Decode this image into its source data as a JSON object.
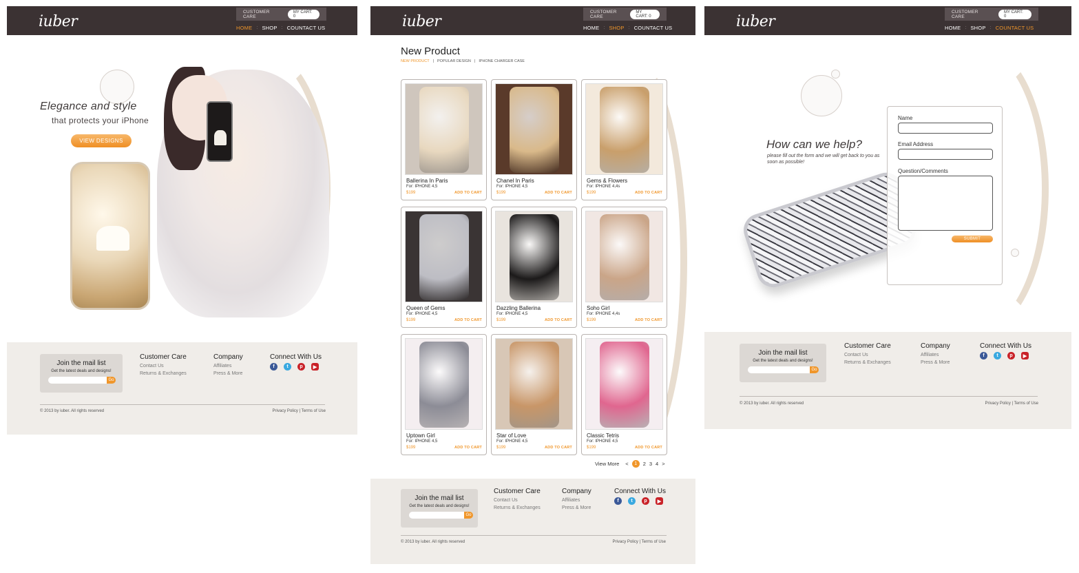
{
  "brand": {
    "logo": "iuber",
    "accent": "#f0962a",
    "header_bg": "#3b3233",
    "footer_bg": "#f0ede9"
  },
  "header": {
    "customer_care": "CUSTOMER CARE",
    "cart": "MY CART: 0",
    "nav": [
      "HOME",
      "SHOP",
      "COUNTACT US"
    ]
  },
  "home": {
    "title": "Elegance and style",
    "subtitle": "that protects your iPhone",
    "cta": "VIEW DESIGNS"
  },
  "shop": {
    "title": "New Product",
    "tabs": [
      "NEW PRODUCT",
      "POPULAR DESIGN",
      "IPHONE CHARGER CASE"
    ],
    "add_label": "ADD TO CART",
    "products": [
      {
        "name": "Ballerina In Paris",
        "for": "For: IPHONE 4,5",
        "price": "$199",
        "bg": "#cfc6bd",
        "case": "#e8d8bf"
      },
      {
        "name": "Chanel In Paris",
        "for": "For: IPHONE 4,5",
        "price": "$199",
        "bg": "#5a3a2a",
        "case": "#d9b98a"
      },
      {
        "name": "Gems & Flowers",
        "for": "For: IPHONE 4,4s",
        "price": "$199",
        "bg": "#f3e9dc",
        "case": "#c99f6b"
      },
      {
        "name": "Queen of Gems",
        "for": "For: IPHONE 4,5",
        "price": "$199",
        "bg": "#3a3434",
        "case": "#bdbdc4"
      },
      {
        "name": "Dazzling Ballerina",
        "for": "For: IPHONE 4,5",
        "price": "$199",
        "bg": "#e9e4de",
        "case": "#1c1a1a"
      },
      {
        "name": "Soho Girl",
        "for": "For: IPHONE 4,4s",
        "price": "$199",
        "bg": "#f1e7e3",
        "case": "#caa588"
      },
      {
        "name": "Uptown Girl",
        "for": "For: IPHONE 4,5",
        "price": "$199",
        "bg": "#f4eef0",
        "case": "#8c8c96"
      },
      {
        "name": "Star of Love",
        "for": "For: IPHONE 4,5",
        "price": "$199",
        "bg": "#d8c7b6",
        "case": "#c89668"
      },
      {
        "name": "Classic Tetris",
        "for": "For: IPHONE 4,5",
        "price": "$199",
        "bg": "#f5eef1",
        "case": "#e0668f"
      }
    ],
    "view_more": "View More",
    "pages": [
      "<",
      "1",
      "2",
      "3",
      "4",
      ">"
    ]
  },
  "contact": {
    "title": "How can we help?",
    "subtitle": "please fill out the form and we will get back to you as soon as possible!",
    "name_label": "Name",
    "email_label": "Email Address",
    "question_label": "Question/Comments",
    "submit": "SUBMIT"
  },
  "footer": {
    "mail_title": "Join the mail list",
    "mail_sub": "Get the latest deals and designs!",
    "go": "Go",
    "customer_care": {
      "title": "Customer Care",
      "links": [
        "Contact Us",
        "Returns & Exchanges"
      ]
    },
    "company": {
      "title": "Company",
      "links": [
        "Affiliates",
        "Press & More"
      ]
    },
    "connect": {
      "title": "Connect With Us",
      "icons": [
        "facebook-icon",
        "twitter-icon",
        "pinterest-icon",
        "youtube-icon"
      ]
    },
    "copyright": "© 2013 by iuber. All rights reserved",
    "legal": "Privacy Policy | Terms of Use"
  }
}
